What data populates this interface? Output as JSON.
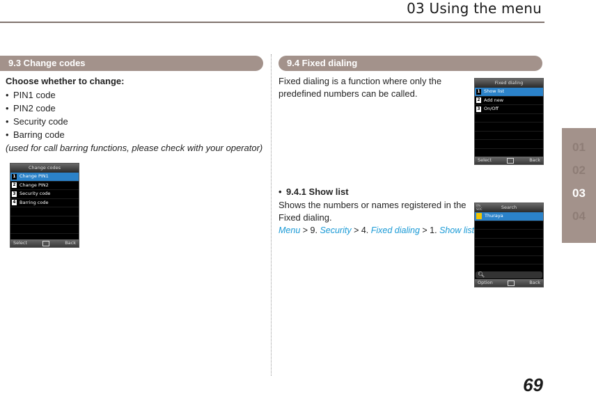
{
  "header": {
    "title": "03 Using the menu"
  },
  "left": {
    "section_title": "9.3  Change codes",
    "intro": "Choose whether to change:",
    "bullets": [
      "PIN1 code",
      "PIN2 code",
      "Security code",
      "Barring code"
    ],
    "note": "(used for call barring functions, please check with your operator)",
    "phone": {
      "title": "Change codes",
      "items": [
        {
          "num": "1",
          "label": "Change PIN1",
          "selected": true
        },
        {
          "num": "2",
          "label": "Change PIN2"
        },
        {
          "num": "3",
          "label": "Security code"
        },
        {
          "num": "4",
          "label": "Barring code"
        }
      ],
      "soft_left": "Select",
      "soft_right": "Back"
    }
  },
  "right": {
    "section_title": "9.4  Fixed dialing",
    "intro_line1": "Fixed dialing is a function where only the",
    "intro_line2": "predefined numbers can be called.",
    "phone1": {
      "title": "Fixed dialing",
      "items": [
        {
          "num": "1",
          "label": "Show list",
          "selected": true
        },
        {
          "num": "2",
          "label": "Add new"
        },
        {
          "num": "3",
          "label": "On/Off"
        }
      ],
      "soft_left": "Select",
      "soft_right": "Back"
    },
    "sub_title": "9.4.1  Show list",
    "sub_line1": "Shows the numbers or names registered in the",
    "sub_line2": "Fixed dialing.",
    "path": {
      "p1": "Menu",
      "s1": " > 9. ",
      "p2": "Security",
      "s2": " > 4. ",
      "p3": "Fixed dialing",
      "s3": " > 1. ",
      "p4": "Show list"
    },
    "phone2": {
      "title": "Search",
      "status": "0%\nSOC",
      "items": [
        {
          "label": "Thuraya",
          "selected": true
        }
      ],
      "search_icon": "magnifier-icon",
      "soft_left": "Option",
      "soft_right": "Back"
    }
  },
  "side_tabs": [
    "01",
    "02",
    "03",
    "04"
  ],
  "side_active": "03",
  "page_number": "69",
  "colors": {
    "accent_bar": "#a3928b",
    "rule": "#7f736d",
    "link": "#1a9ad6",
    "phone_highlight": "#2b82c9"
  }
}
